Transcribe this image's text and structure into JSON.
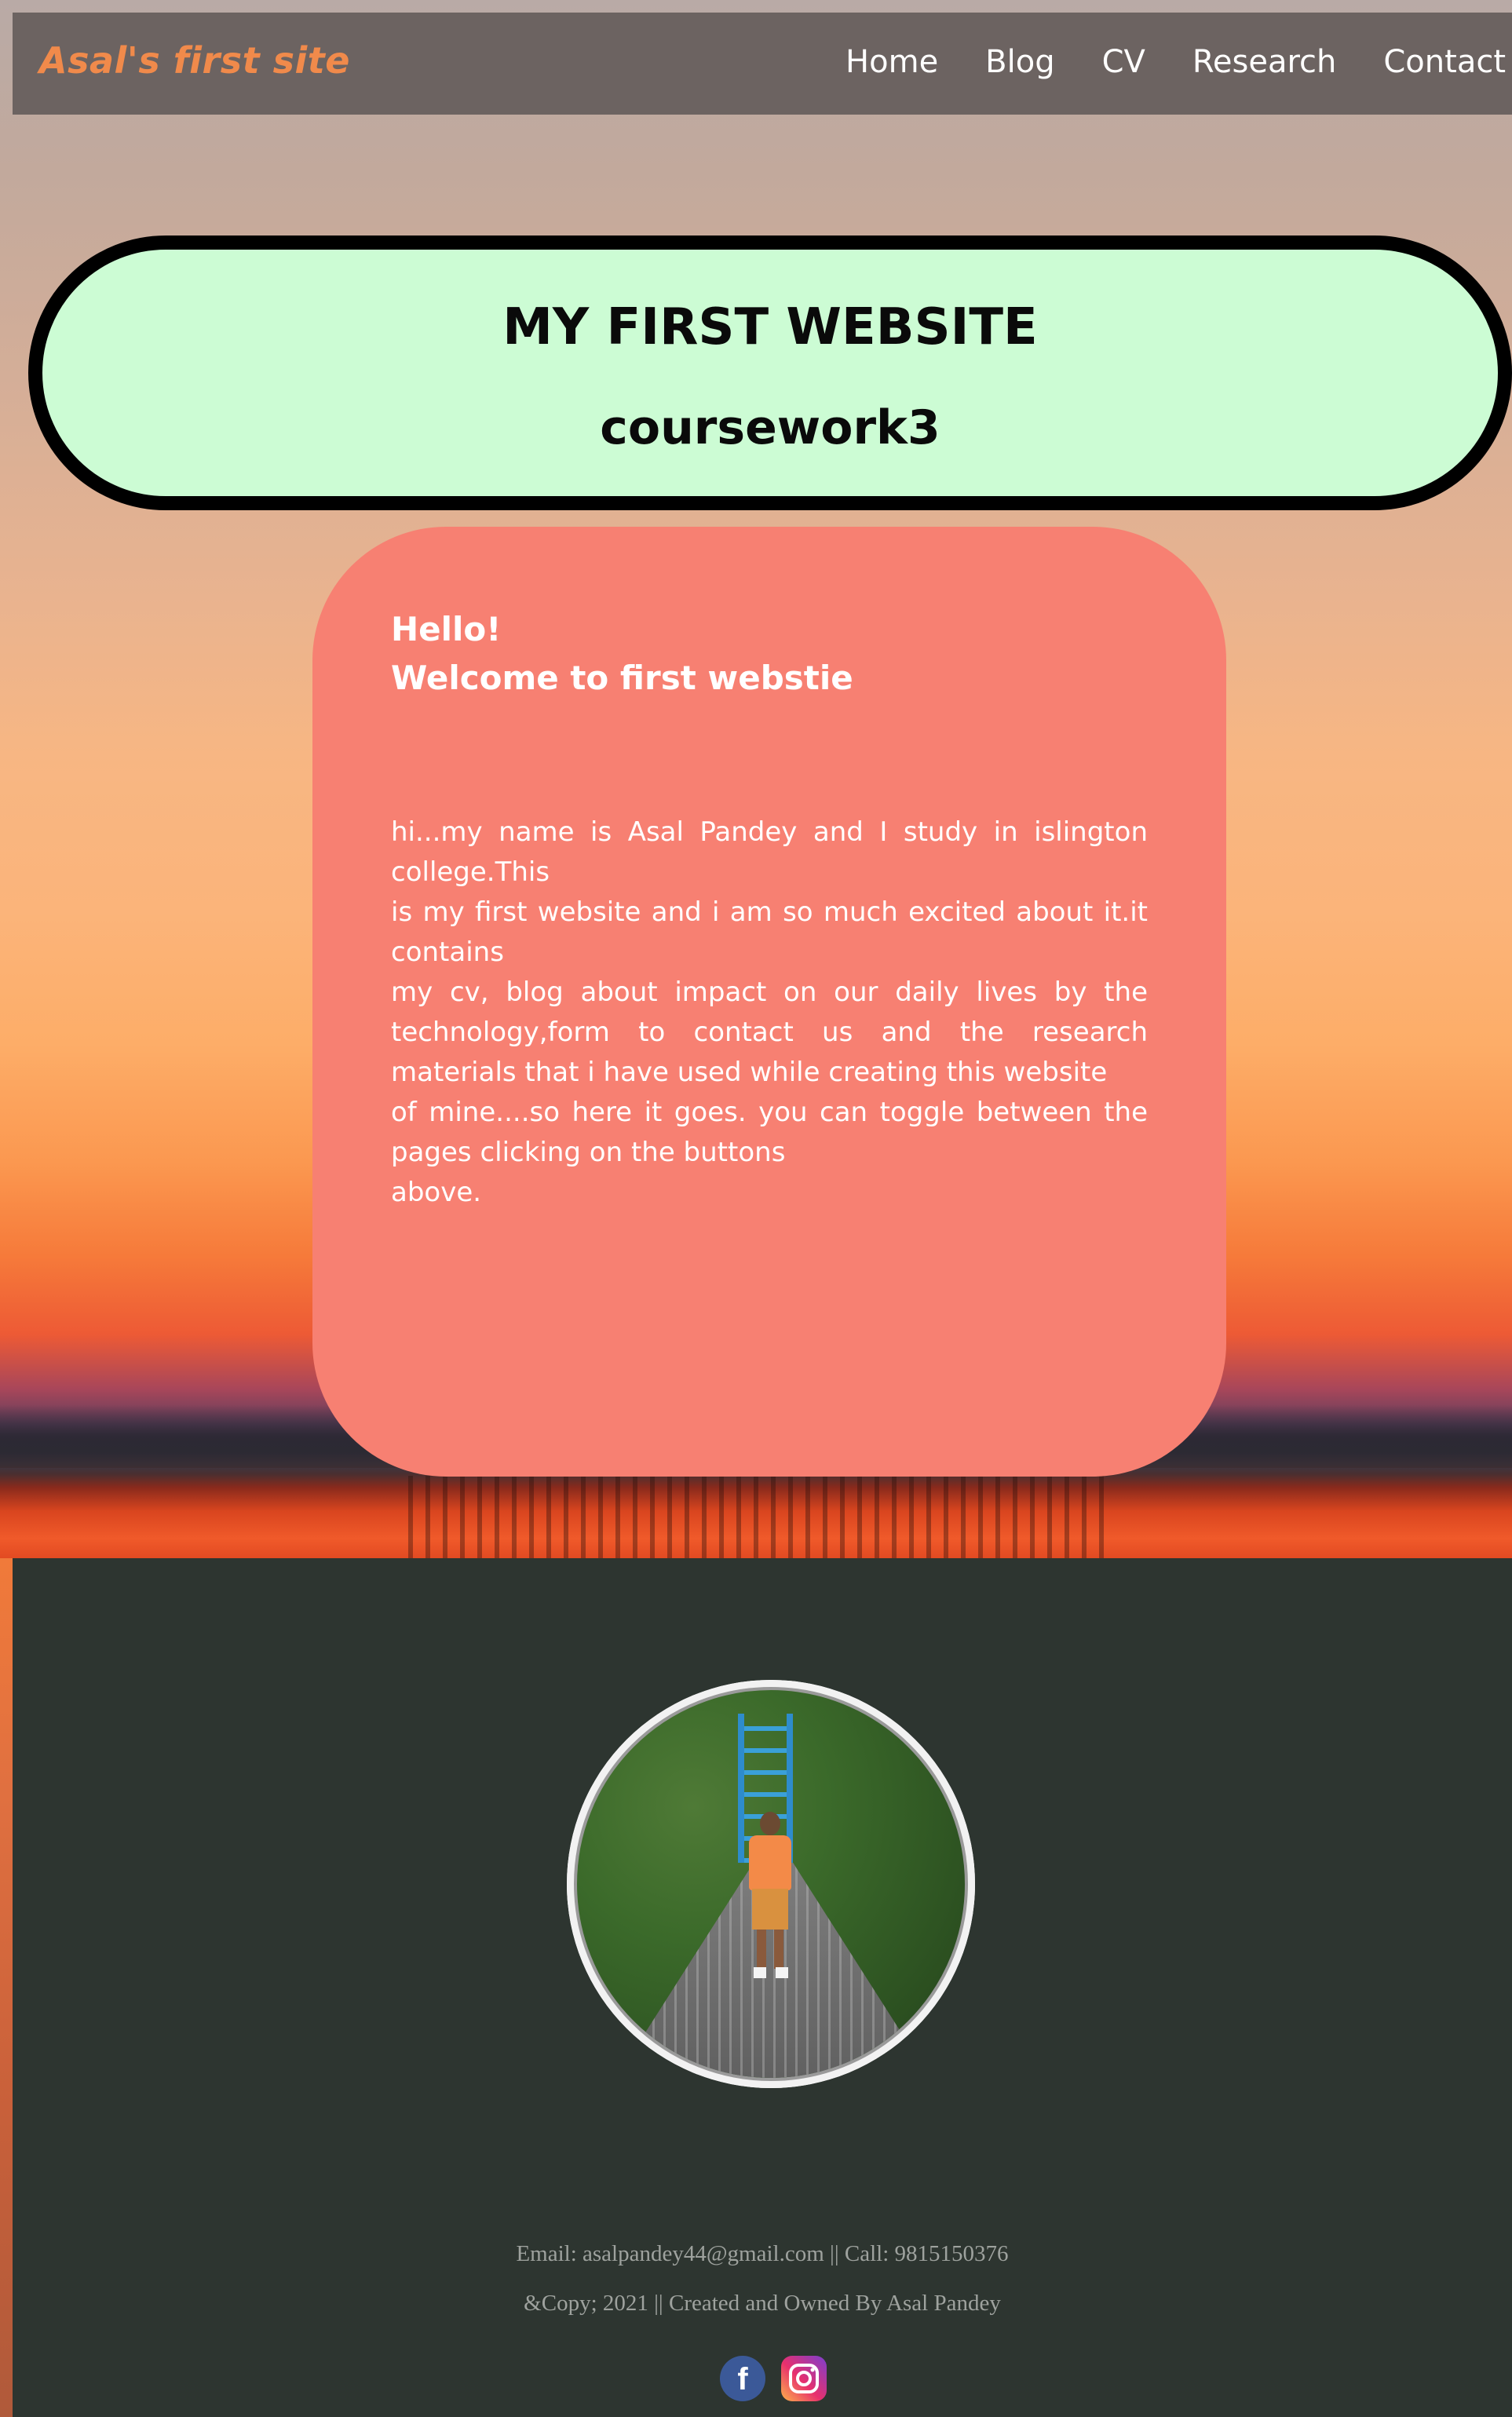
{
  "navbar": {
    "brand": "Asal's first site",
    "links": [
      {
        "label": "Home"
      },
      {
        "label": "Blog"
      },
      {
        "label": "CV"
      },
      {
        "label": "Research"
      },
      {
        "label": "Contact"
      }
    ]
  },
  "hero": {
    "title": "MY FIRST WEBSITE",
    "subtitle": "coursework3"
  },
  "welcome": {
    "greeting_line1": "Hello!",
    "greeting_line2": "Welcome to first webstie",
    "paragraph_lines": [
      "hi...my name is Asal Pandey and I study in islington college.This",
      "is my first website and i am so much excited about it.it contains",
      "my cv, blog about impact on our daily lives by the technology,form to contact us and the research materials that i have used while creating this website",
      "of mine....so here it goes. you can toggle between the pages clicking on the buttons",
      "above."
    ]
  },
  "footer": {
    "email_line": "Email: asalpandey44@gmail.com || Call: 9815150376",
    "copyright_line": "&Copy; 2021 || Created and Owned By Asal Pandey",
    "social": [
      {
        "icon": "facebook-icon",
        "label": "f"
      },
      {
        "icon": "instagram-icon"
      }
    ]
  },
  "colors": {
    "navbar_bg": "#6c6361",
    "brand": "#f08a4b",
    "title_pill_bg": "#ccfcd4",
    "welcome_card_bg": "#f78072",
    "footer_bg": "#2d3530",
    "footer_text": "#9ea29e"
  }
}
